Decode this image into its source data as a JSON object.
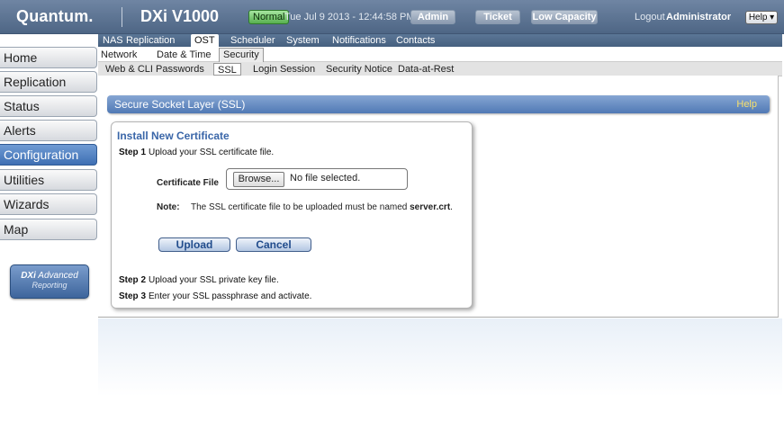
{
  "header": {
    "logo": "Quantum.",
    "product": "DXi V1000",
    "status": "Normal",
    "datetime": "Tue Jul 9 2013 - 12:44:58 PM PDT",
    "buttons": {
      "admin": "Admin",
      "ticket": "Ticket",
      "low_capacity": "Low Capacity"
    },
    "logout": "Logout",
    "user": "Administrator",
    "help": "Help ▾"
  },
  "leftnav": {
    "items": [
      {
        "label": "Home",
        "active": false
      },
      {
        "label": "Replication",
        "active": false
      },
      {
        "label": "Status",
        "active": false
      },
      {
        "label": "Alerts",
        "active": false
      },
      {
        "label": "Configuration",
        "active": true
      },
      {
        "label": "Utilities",
        "active": false
      },
      {
        "label": "Wizards",
        "active": false
      },
      {
        "label": "Map",
        "active": false
      }
    ],
    "advanced_reporting": {
      "brand": "DXi",
      "line1": "Advanced",
      "line2": "Reporting"
    }
  },
  "tabs": {
    "level1": [
      "NAS",
      "Replication",
      "OST",
      "Scheduler",
      "System",
      "Notifications",
      "Contacts"
    ],
    "level1_active": "OST",
    "level2": [
      "Network",
      "Date & Time",
      "Security"
    ],
    "level2_active": "Security",
    "level3": [
      "Web & CLI Passwords",
      "SSL",
      "Login Session",
      "Security Notice",
      "Data-at-Rest"
    ],
    "level3_active": "SSL"
  },
  "section": {
    "title": "Secure Socket Layer (SSL)",
    "help": "Help"
  },
  "panel": {
    "title": "Install New Certificate",
    "step1": {
      "label": "Step 1",
      "text": "Upload your SSL certificate file."
    },
    "certificate_file_label": "Certificate File",
    "browse_label": "Browse...",
    "file_status": "No file selected.",
    "note_label": "Note:",
    "note_text": "The SSL certificate file to be uploaded must be named",
    "note_filename": "server.crt",
    "upload_label": "Upload",
    "cancel_label": "Cancel",
    "step2": {
      "label": "Step 2",
      "text": "Upload your SSL private key file."
    },
    "step3": {
      "label": "Step 3",
      "text": "Enter your SSL passphrase and activate."
    }
  }
}
